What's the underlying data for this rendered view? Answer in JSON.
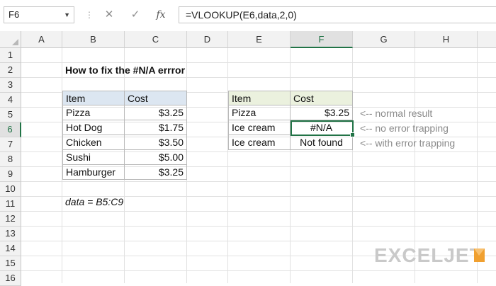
{
  "name_box": "F6",
  "formula_bar": {
    "cancel_icon": "✕",
    "enter_icon": "✓",
    "fx_label": "fx",
    "formula": "=VLOOKUP(E6,data,2,0)"
  },
  "columns": [
    "A",
    "B",
    "C",
    "D",
    "E",
    "F",
    "G",
    "H"
  ],
  "selected_column": "F",
  "rows": [
    "1",
    "2",
    "3",
    "4",
    "5",
    "6",
    "7",
    "8",
    "9",
    "10",
    "11",
    "12",
    "13",
    "14",
    "15",
    "16"
  ],
  "selected_row": "6",
  "title": "How to fix the #N/A errror",
  "data_table": {
    "headers": [
      "Item",
      "Cost"
    ],
    "rows": [
      [
        "Pizza",
        "$3.25"
      ],
      [
        "Hot Dog",
        "$1.75"
      ],
      [
        "Chicken",
        "$3.50"
      ],
      [
        "Sushi",
        "$5.00"
      ],
      [
        "Hamburger",
        "$3.25"
      ]
    ],
    "header_color": "#dce6f1"
  },
  "lookup_table": {
    "headers": [
      "Item",
      "Cost"
    ],
    "rows": [
      [
        "Pizza",
        "$3.25"
      ],
      [
        "Ice cream",
        "#N/A"
      ],
      [
        "Ice cream",
        "Not found"
      ]
    ],
    "header_color": "#ebf1de"
  },
  "notes": [
    "<-- normal result",
    "<-- no error trapping",
    "<-- with error trapping"
  ],
  "named_range_note": "data = B5:C9",
  "logo": "EXCELJET",
  "accent_color": "#217346"
}
